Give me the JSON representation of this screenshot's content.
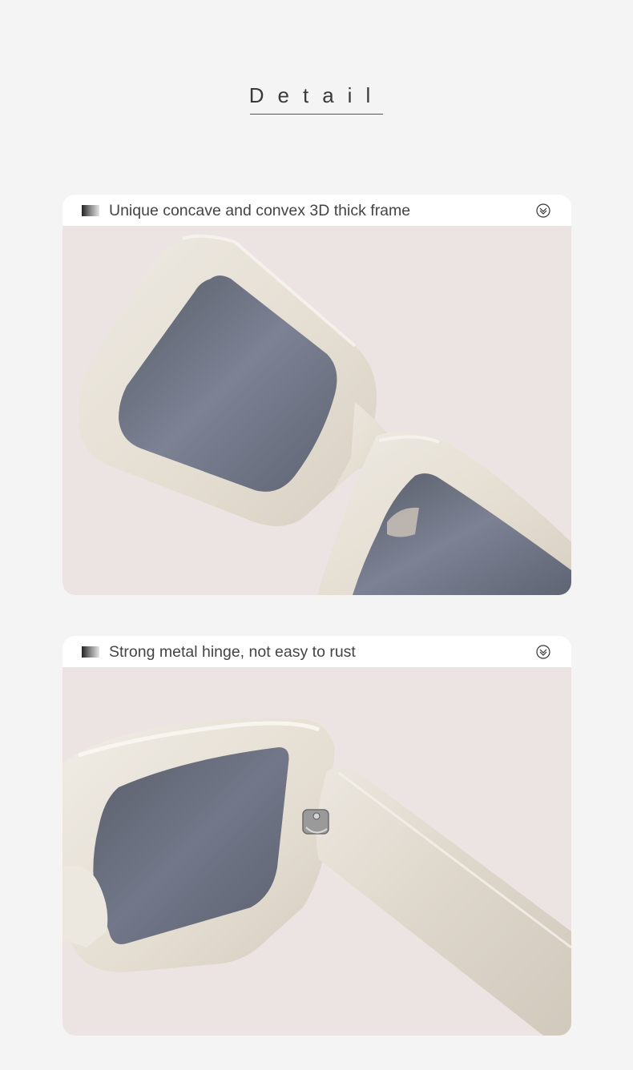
{
  "header": {
    "title": "Detail"
  },
  "cards": [
    {
      "label": "Unique concave and convex 3D thick frame",
      "icon": "chevron-down-circle-icon"
    },
    {
      "label": "Strong metal hinge, not easy to rust",
      "icon": "chevron-down-circle-icon"
    }
  ],
  "colors": {
    "page_background": "#f4f4f4",
    "photo_background": "#ebe4e2",
    "frame": "#e5dfd5",
    "lens": "#6b707f",
    "text": "#444444"
  }
}
